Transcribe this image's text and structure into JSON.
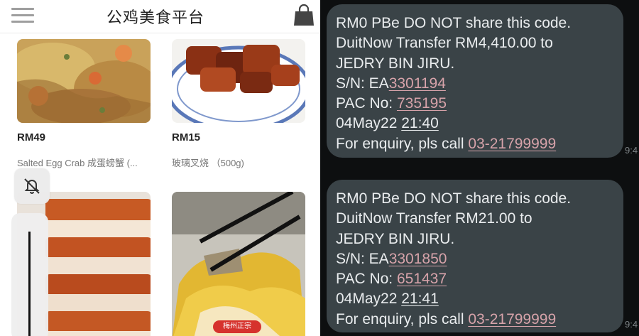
{
  "app": {
    "title": "公鸡美食平台",
    "products": [
      {
        "price": "RM49",
        "name": "Salted Egg Crab 成蛋螃蟹 (..."
      },
      {
        "price": "RM15",
        "name": "玻璃叉烧 （500g)"
      }
    ],
    "badge": "梅州正宗"
  },
  "sms": {
    "messages": [
      {
        "line1": "RM0 PBe DO NOT share this code.",
        "line2": "DuitNow Transfer RM4,410.00 to",
        "line3": "JEDRY BIN JIRU.",
        "sn_label": "S/N: EA",
        "sn_number": "3301194",
        "pac_label": "PAC No: ",
        "pac_number": "735195",
        "date": "04May22 ",
        "time": "21:40",
        "enquiry_label": "For enquiry, pls call ",
        "phone": "03-21799999",
        "timestamp": "9:4"
      },
      {
        "line1": "RM0 PBe DO NOT share this code.",
        "line2": "DuitNow Transfer RM21.00 to",
        "line3": "JEDRY BIN JIRU.",
        "sn_label": "S/N: EA",
        "sn_number": "3301850",
        "pac_label": "PAC No: ",
        "pac_number": "651437",
        "date": "04May22 ",
        "time": "21:41",
        "enquiry_label": "For enquiry, pls call ",
        "phone": "03-21799999",
        "timestamp": "9:4"
      }
    ]
  }
}
